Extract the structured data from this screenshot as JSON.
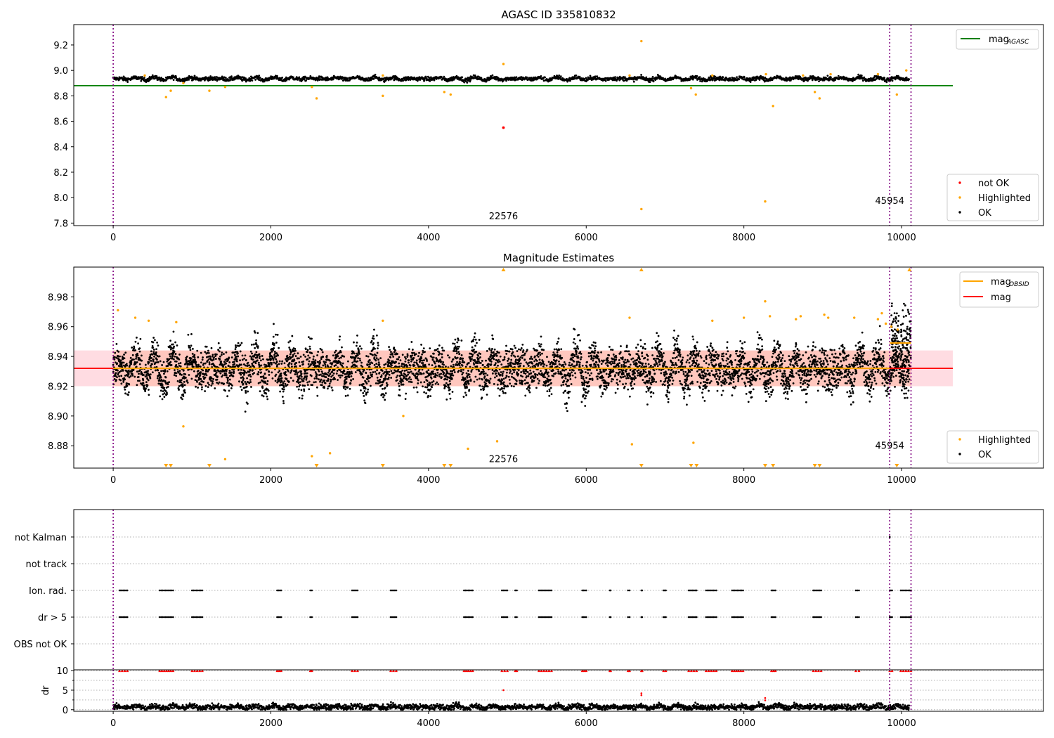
{
  "chart_data": [
    {
      "type": "scatter",
      "title": "AGASC ID 335810832",
      "xlim": [
        -500,
        11800
      ],
      "ylim": [
        7.78,
        9.36
      ],
      "x_ticks": [
        0,
        2000,
        4000,
        6000,
        8000,
        10000
      ],
      "y_ticks": [
        7.8,
        8.0,
        8.2,
        8.4,
        8.6,
        8.8,
        9.0,
        9.2
      ],
      "ok_band": {
        "x_range": [
          0,
          10100
        ],
        "center": 8.935,
        "amplitude": 0.012,
        "noise": 0.008
      },
      "reference_line": {
        "name": "mag_AGASC",
        "value": 8.88,
        "x_range": [
          -500,
          10650
        ],
        "color": "#008000"
      },
      "highlighted_points": [
        {
          "x": 670,
          "y": 8.79
        },
        {
          "x": 730,
          "y": 8.84
        },
        {
          "x": 890,
          "y": 8.9
        },
        {
          "x": 1220,
          "y": 8.84
        },
        {
          "x": 1420,
          "y": 8.87
        },
        {
          "x": 2520,
          "y": 8.87
        },
        {
          "x": 2580,
          "y": 8.78
        },
        {
          "x": 3420,
          "y": 8.8
        },
        {
          "x": 4200,
          "y": 8.83
        },
        {
          "x": 4280,
          "y": 8.81
        },
        {
          "x": 4950,
          "y": 9.05
        },
        {
          "x": 6700,
          "y": 9.23
        },
        {
          "x": 6700,
          "y": 7.91
        },
        {
          "x": 7330,
          "y": 8.86
        },
        {
          "x": 7390,
          "y": 8.81
        },
        {
          "x": 8270,
          "y": 7.97
        },
        {
          "x": 8370,
          "y": 8.72
        },
        {
          "x": 8900,
          "y": 8.83
        },
        {
          "x": 8960,
          "y": 8.78
        },
        {
          "x": 9940,
          "y": 8.81
        },
        {
          "x": 10060,
          "y": 9.0
        },
        {
          "x": 400,
          "y": 8.96
        },
        {
          "x": 3420,
          "y": 8.96
        },
        {
          "x": 6550,
          "y": 8.96
        },
        {
          "x": 7600,
          "y": 8.96
        },
        {
          "x": 8280,
          "y": 8.97
        },
        {
          "x": 8750,
          "y": 8.96
        },
        {
          "x": 9100,
          "y": 8.97
        },
        {
          "x": 9700,
          "y": 8.97
        }
      ],
      "not_ok_points": [
        {
          "x": 4950,
          "y": 8.55
        }
      ],
      "obsid_markers": [
        {
          "x": 0
        },
        {
          "x": 9850
        },
        {
          "x": 10120
        }
      ],
      "obsid_labels": [
        {
          "text": "22576",
          "x": 4950,
          "y": 7.83
        },
        {
          "text": "45954",
          "x": 9850,
          "y": 7.95
        }
      ],
      "legend_lines": [
        {
          "label": "mag",
          "sub": "AGASC",
          "color": "#008000"
        }
      ],
      "legend_points": [
        {
          "label": "not OK",
          "color": "#ff0000"
        },
        {
          "label": "Highlighted",
          "color": "#ffa500"
        },
        {
          "label": "OK",
          "color": "#000000"
        }
      ]
    },
    {
      "type": "scatter",
      "title": "Magnitude Estimates",
      "xlim": [
        -500,
        11800
      ],
      "ylim": [
        8.865,
        9.0
      ],
      "x_ticks": [
        0,
        2000,
        4000,
        6000,
        8000,
        10000
      ],
      "y_ticks": [
        8.88,
        8.9,
        8.92,
        8.94,
        8.96,
        8.98
      ],
      "ok_band": {
        "x_range": [
          0,
          10100
        ],
        "center": 8.932,
        "amplitude": 0.01,
        "noise": 0.007
      },
      "mag_line": {
        "name": "mag",
        "value": 8.932,
        "band": [
          8.92,
          8.944
        ],
        "x_range": [
          -500,
          10650
        ],
        "color": "#ff0000"
      },
      "mag_obsid_segments": [
        {
          "x_range": [
            0,
            9850
          ],
          "value": 8.932
        },
        {
          "x_range": [
            9850,
            10120
          ],
          "value": 8.949
        }
      ],
      "highlighted_points": [
        {
          "x": 60,
          "y": 8.971
        },
        {
          "x": 280,
          "y": 8.966
        },
        {
          "x": 450,
          "y": 8.964
        },
        {
          "x": 800,
          "y": 8.963
        },
        {
          "x": 890,
          "y": 8.893
        },
        {
          "x": 1420,
          "y": 8.871
        },
        {
          "x": 2520,
          "y": 8.873
        },
        {
          "x": 2750,
          "y": 8.875
        },
        {
          "x": 3420,
          "y": 8.964
        },
        {
          "x": 3680,
          "y": 8.9
        },
        {
          "x": 4500,
          "y": 8.878
        },
        {
          "x": 4870,
          "y": 8.883
        },
        {
          "x": 6550,
          "y": 8.966
        },
        {
          "x": 6580,
          "y": 8.881
        },
        {
          "x": 7360,
          "y": 8.882
        },
        {
          "x": 7600,
          "y": 8.964
        },
        {
          "x": 8000,
          "y": 8.966
        },
        {
          "x": 8270,
          "y": 8.977
        },
        {
          "x": 8330,
          "y": 8.967
        },
        {
          "x": 8660,
          "y": 8.965
        },
        {
          "x": 8720,
          "y": 8.967
        },
        {
          "x": 9020,
          "y": 8.968
        },
        {
          "x": 9070,
          "y": 8.966
        },
        {
          "x": 9400,
          "y": 8.966
        },
        {
          "x": 9700,
          "y": 8.965
        },
        {
          "x": 9750,
          "y": 8.969
        },
        {
          "x": 9800,
          "y": 8.962
        },
        {
          "x": 9870,
          "y": 8.96
        },
        {
          "x": 9950,
          "y": 8.958
        }
      ],
      "offscale_high": [
        {
          "x": 4950
        },
        {
          "x": 6700
        },
        {
          "x": 10100
        }
      ],
      "offscale_low": [
        {
          "x": 670
        },
        {
          "x": 730
        },
        {
          "x": 1220
        },
        {
          "x": 2580
        },
        {
          "x": 3420
        },
        {
          "x": 4200
        },
        {
          "x": 4280
        },
        {
          "x": 6700
        },
        {
          "x": 7330
        },
        {
          "x": 7400
        },
        {
          "x": 8270
        },
        {
          "x": 8370
        },
        {
          "x": 8900
        },
        {
          "x": 8960
        },
        {
          "x": 9940
        }
      ],
      "obsid_markers": [
        {
          "x": 0
        },
        {
          "x": 9850
        },
        {
          "x": 10120
        }
      ],
      "obsid_labels": [
        {
          "text": "22576",
          "x": 4950,
          "y": 8.869
        },
        {
          "text": "45954",
          "x": 9850,
          "y": 8.878
        }
      ],
      "legend_lines": [
        {
          "label": "mag",
          "sub": "OBSID",
          "color": "#ffa500"
        },
        {
          "label": "mag",
          "sub": "",
          "color": "#ff0000"
        }
      ],
      "legend_points": [
        {
          "label": "Highlighted",
          "color": "#ffa500"
        },
        {
          "label": "OK",
          "color": "#000000"
        }
      ]
    },
    {
      "type": "scatter",
      "xlim": [
        -500,
        11800
      ],
      "categories": [
        "not Kalman",
        "not track",
        "Ion. rad.",
        "dr > 5",
        "OBS not OK"
      ],
      "flag_rows": {
        "Ion. rad.": [
          [
            80,
            180
          ],
          [
            590,
            760
          ],
          [
            1000,
            1130
          ],
          [
            2080,
            2130
          ],
          [
            2500,
            2520
          ],
          [
            3030,
            3100
          ],
          [
            3520,
            3590
          ],
          [
            4450,
            4560
          ],
          [
            4930,
            5000
          ],
          [
            5100,
            5120
          ],
          [
            5400,
            5560
          ],
          [
            5950,
            6000
          ],
          [
            6300,
            6310
          ],
          [
            6530,
            6550
          ],
          [
            6700,
            6710
          ],
          [
            6980,
            7010
          ],
          [
            7300,
            7400
          ],
          [
            7520,
            7650
          ],
          [
            7850,
            7990
          ],
          [
            8350,
            8400
          ],
          [
            8880,
            8980
          ],
          [
            9420,
            9460
          ],
          [
            9850,
            9880
          ],
          [
            9990,
            10120
          ]
        ],
        "dr > 5": [
          [
            80,
            180
          ],
          [
            590,
            760
          ],
          [
            1000,
            1130
          ],
          [
            2080,
            2130
          ],
          [
            2500,
            2520
          ],
          [
            3030,
            3100
          ],
          [
            3520,
            3590
          ],
          [
            4450,
            4560
          ],
          [
            4930,
            5000
          ],
          [
            5100,
            5120
          ],
          [
            5400,
            5560
          ],
          [
            5950,
            6000
          ],
          [
            6300,
            6310
          ],
          [
            6530,
            6550
          ],
          [
            6700,
            6710
          ],
          [
            6980,
            7010
          ],
          [
            7300,
            7400
          ],
          [
            7520,
            7650
          ],
          [
            7850,
            7990
          ],
          [
            8350,
            8400
          ],
          [
            8880,
            8980
          ],
          [
            9420,
            9460
          ],
          [
            9850,
            9880
          ],
          [
            9990,
            10120
          ]
        ],
        "not Kalman": [
          [
            9850,
            9850
          ]
        ]
      },
      "obsid_markers": [
        {
          "x": 0
        },
        {
          "x": 9850
        },
        {
          "x": 10120
        }
      ]
    },
    {
      "type": "scatter",
      "ylabel": "dr",
      "xlim": [
        -500,
        11800
      ],
      "ylim": [
        -0.4,
        10.2
      ],
      "x_ticks": [
        0,
        2000,
        4000,
        6000,
        8000,
        10000
      ],
      "y_ticks": [
        0,
        5,
        10
      ],
      "ok_band": {
        "x_range": [
          0,
          10100
        ],
        "center": 0.7,
        "amplitude": 0.35,
        "noise": 0.35
      },
      "clipped_points": [
        [
          80,
          180
        ],
        [
          590,
          760
        ],
        [
          1000,
          1130
        ],
        [
          2080,
          2130
        ],
        [
          2500,
          2520
        ],
        [
          3030,
          3100
        ],
        [
          3520,
          3590
        ],
        [
          4450,
          4560
        ],
        [
          4930,
          5000
        ],
        [
          5100,
          5120
        ],
        [
          5400,
          5560
        ],
        [
          5950,
          6000
        ],
        [
          6300,
          6310
        ],
        [
          6530,
          6550
        ],
        [
          6700,
          6710
        ],
        [
          6980,
          7010
        ],
        [
          7300,
          7400
        ],
        [
          7520,
          7650
        ],
        [
          7850,
          7990
        ],
        [
          8350,
          8400
        ],
        [
          8880,
          8980
        ],
        [
          9420,
          9460
        ],
        [
          9850,
          9880
        ],
        [
          9990,
          10120
        ]
      ],
      "red_points": [
        {
          "x": 4950,
          "y": 5.0
        },
        {
          "x": 6700,
          "y": 4.2
        },
        {
          "x": 6700,
          "y": 3.7
        },
        {
          "x": 8270,
          "y": 3.0
        },
        {
          "x": 8270,
          "y": 2.4
        }
      ],
      "obsid_markers": [
        {
          "x": 0
        },
        {
          "x": 9850
        },
        {
          "x": 10120
        }
      ]
    }
  ]
}
